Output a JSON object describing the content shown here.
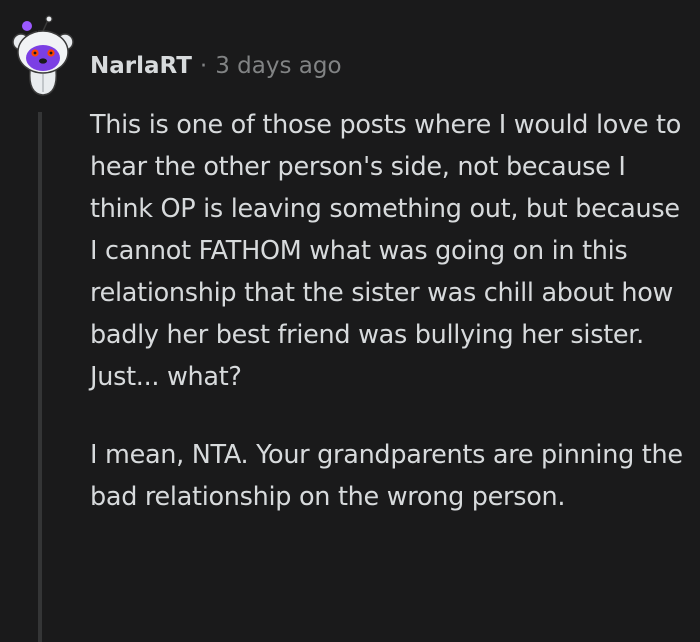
{
  "comment": {
    "author": "NarlaRT",
    "separator": "·",
    "timestamp": "3 days ago",
    "avatar_icon": "snoo-avatar-icon",
    "paragraphs": [
      "This is one of those posts where I would love to hear the other person's side, not because I think OP is leaving something out, but because I cannot FATHOM what was going on in this relationship that the sister was chill about how badly her best friend was bullying her sister. Just... what?",
      "I mean, NTA. Your grandparents are pinning the bad relationship on the wrong person."
    ]
  },
  "colors": {
    "background": "#1a1a1b",
    "text": "#d7dadc",
    "meta": "#818384",
    "thread_line": "#343536",
    "avatar_accent": "#7b3fe4"
  }
}
